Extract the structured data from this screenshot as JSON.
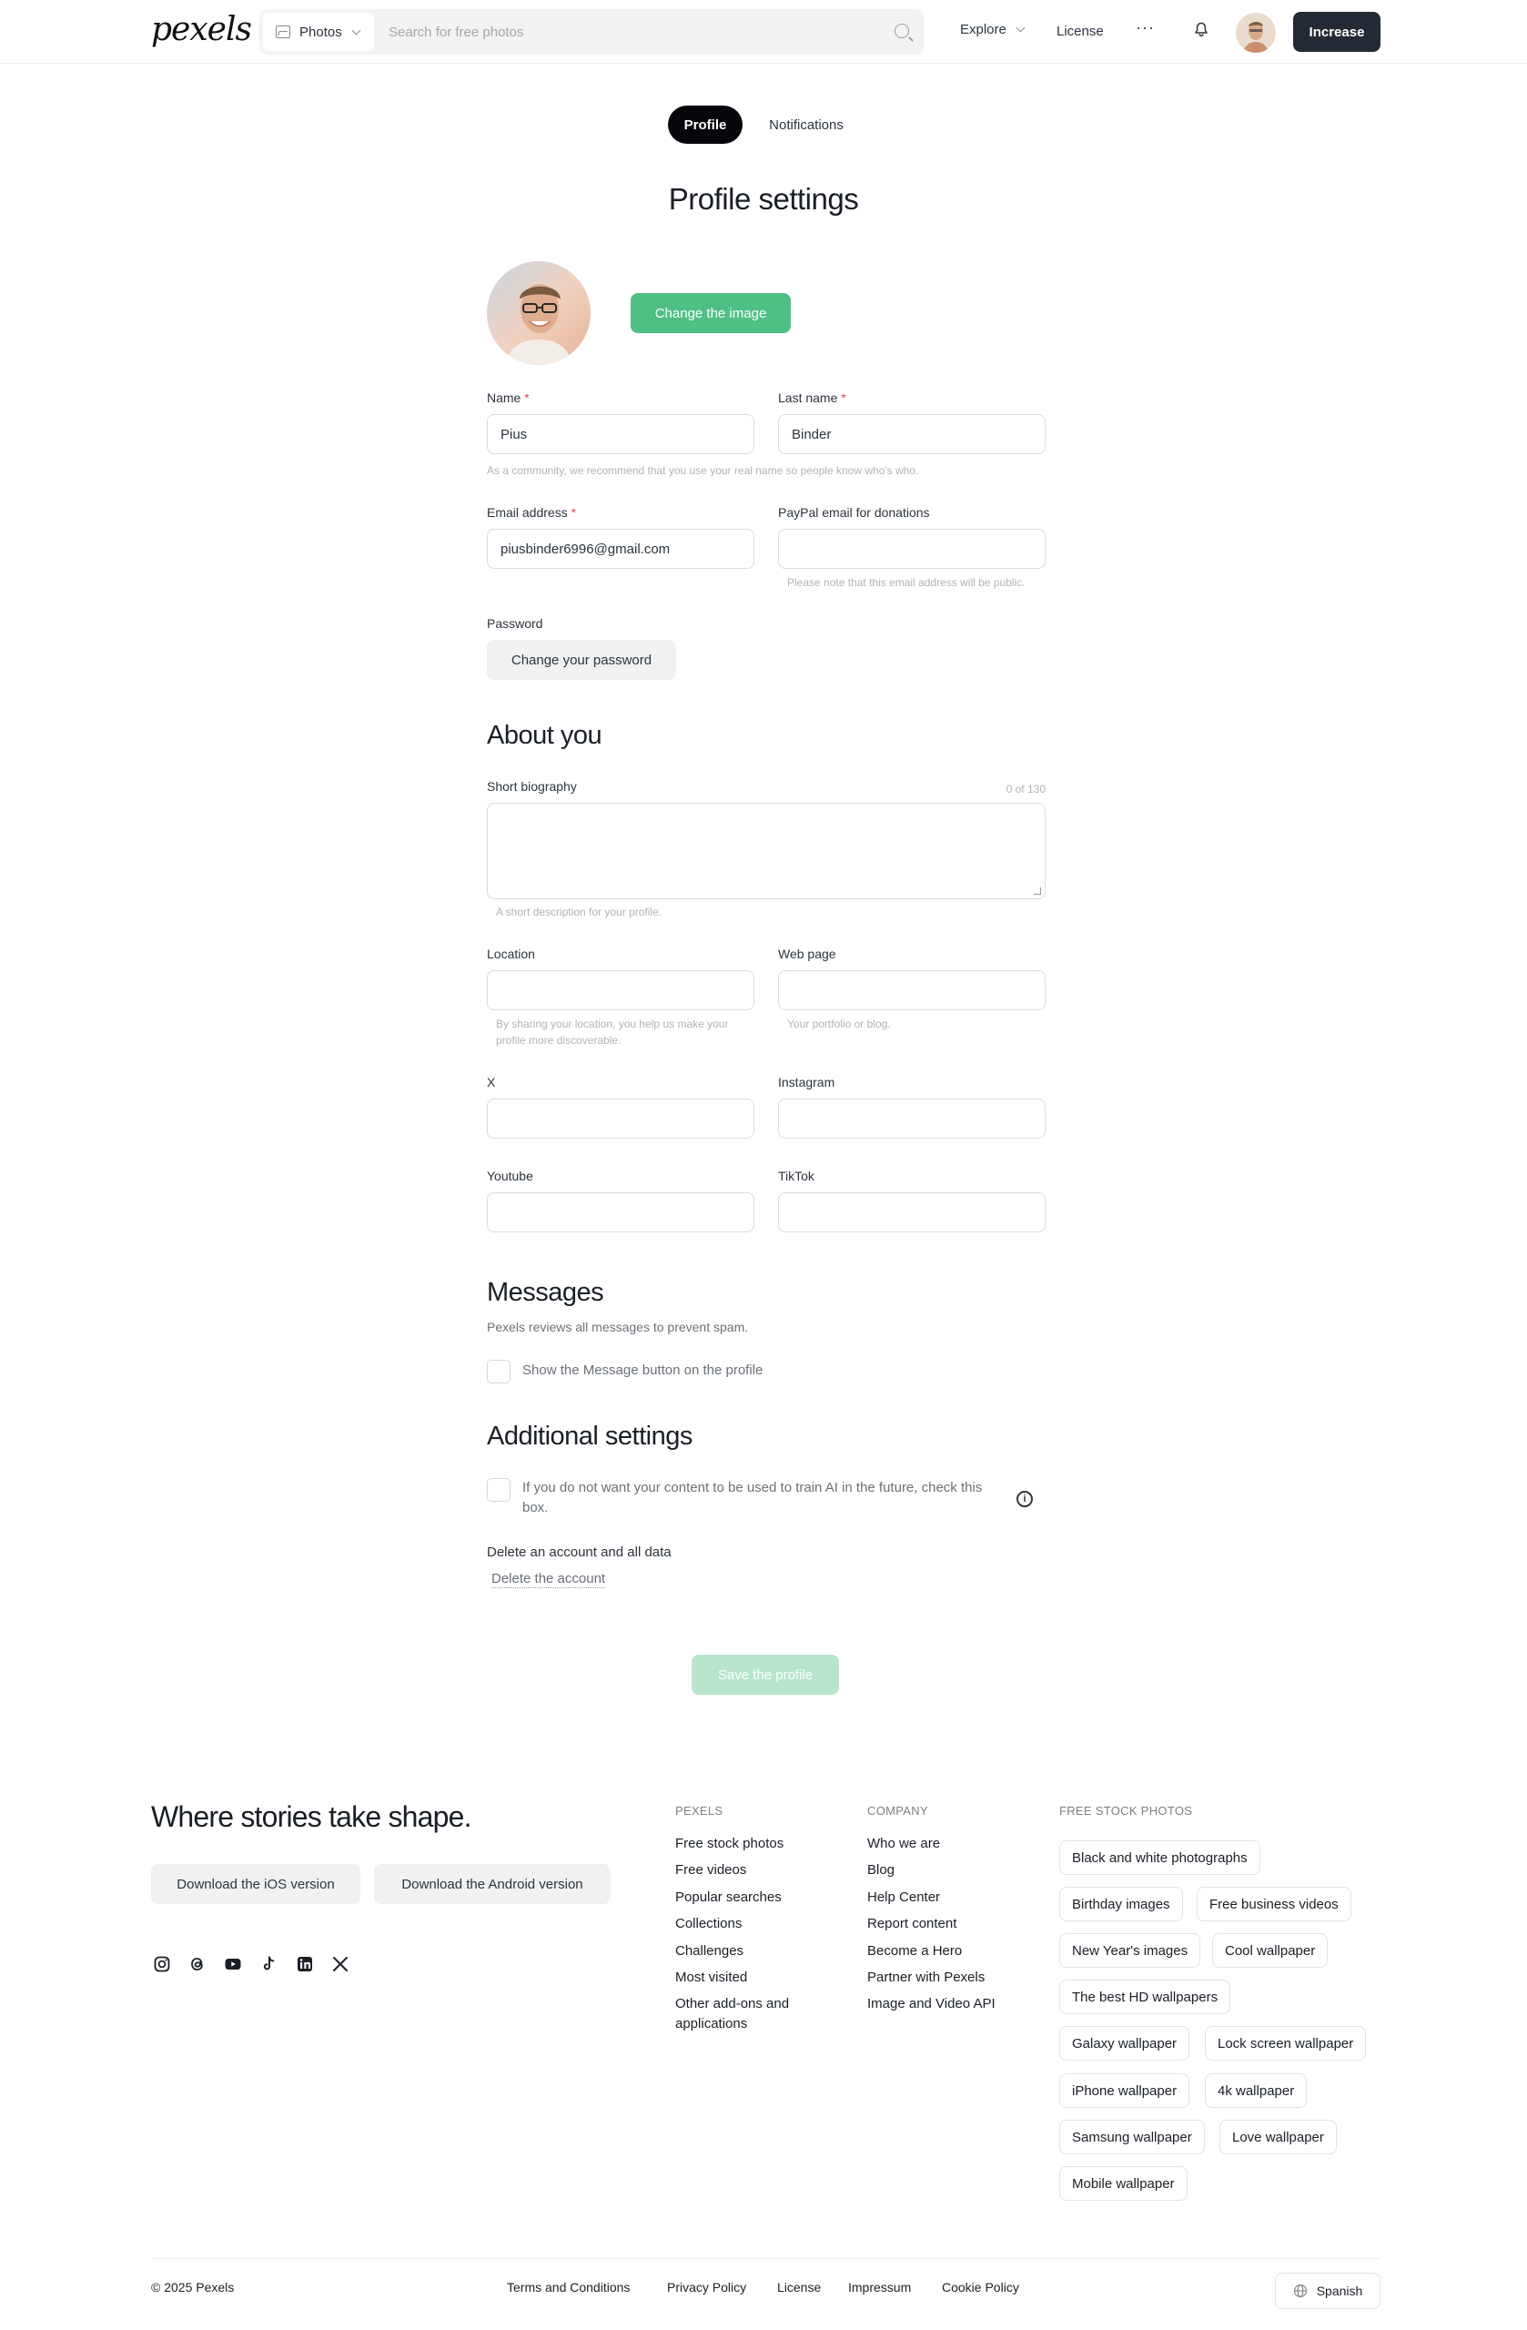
{
  "header": {
    "logo": "pexels",
    "search_type": "Photos",
    "search_placeholder": "Search for free photos",
    "explore": "Explore",
    "license": "License",
    "more": "···",
    "increase": "Increase"
  },
  "tabs": {
    "profile": "Profile",
    "notifications": "Notifications"
  },
  "title": "Profile settings",
  "profile": {
    "change_image": "Change the image",
    "name_label": "Name",
    "name_value": "Pius",
    "lastname_label": "Last name",
    "lastname_value": "Binder",
    "name_hint": "As a community, we recommend that you use your real name so people know who's who.",
    "email_label": "Email address",
    "email_value": "piusbinder6996@gmail.com",
    "paypal_label": "PayPal email for donations",
    "paypal_value": "",
    "paypal_hint": "Please note that this email address will be public.",
    "password_label": "Password",
    "change_password": "Change your password",
    "required_mark": "*"
  },
  "about": {
    "heading": "About you",
    "bio_label": "Short biography",
    "bio_counter": "0 of 130",
    "bio_hint": "A short description for your profile.",
    "location_label": "Location",
    "location_hint": "By sharing your location, you help us make your profile more discoverable.",
    "web_label": "Web page",
    "web_hint": "Your portfolio or blog.",
    "x_label": "X",
    "instagram_label": "Instagram",
    "youtube_label": "Youtube",
    "tiktok_label": "TikTok"
  },
  "messages": {
    "heading": "Messages",
    "desc": "Pexels reviews all messages to prevent spam.",
    "checkbox": "Show the Message button on the profile"
  },
  "additional": {
    "heading": "Additional settings",
    "ai_checkbox": "If you do not want your content to be used to train AI in the future, check this box.",
    "info": "i",
    "delete_label": "Delete an account and all data",
    "delete_link": "Delete the account"
  },
  "save": "Save the profile",
  "footer": {
    "tagline": "Where stories take shape.",
    "ios": "Download the iOS version",
    "android": "Download the Android version",
    "col_pexels": {
      "heading": "PEXELS",
      "items": [
        "Free stock photos",
        "Free videos",
        "Popular searches",
        "Collections",
        "Challenges",
        "Most visited",
        "Other add-ons and applications"
      ]
    },
    "col_company": {
      "heading": "COMPANY",
      "items": [
        "Who we are",
        "Blog",
        "Help Center",
        "Report content",
        "Become a Hero",
        "Partner with Pexels",
        "Image and Video API"
      ]
    },
    "col_free": {
      "heading": "FREE STOCK PHOTOS",
      "tags": [
        "Black and white photographs",
        "Birthday images",
        "Free business videos",
        "New Year's images",
        "Cool wallpaper",
        "The best HD wallpapers",
        "Galaxy wallpaper",
        "Lock screen wallpaper",
        "iPhone wallpaper",
        "4k wallpaper",
        "Samsung wallpaper",
        "Love wallpaper",
        "Mobile wallpaper"
      ]
    },
    "copyright": "© 2025 Pexels",
    "legal": [
      "Terms and Conditions",
      "Privacy Policy",
      "License",
      "Impressum",
      "Cookie Policy"
    ],
    "language": "Spanish"
  },
  "colors": {
    "accent": "#4fbf84",
    "dark": "#232a34",
    "save_disabled": "#b8e5cc"
  }
}
